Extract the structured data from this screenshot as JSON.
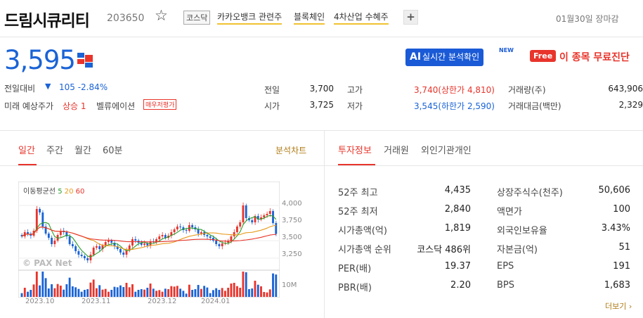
{
  "header": {
    "stock_name": "드림시큐리티",
    "stock_code": "203650",
    "star_icon": "☆",
    "market_badge": "코스닥",
    "themes": [
      "카카오뱅크 관련주",
      "블록체인",
      "4차산업 수혜주"
    ],
    "plus_label": "+",
    "date_text": "01월30일 장마감"
  },
  "price": {
    "current": "3,595",
    "change_label": "전일대비",
    "change_arrow": "▼",
    "change_text": "105 -2.84%",
    "forecast_label": "미래 예상주가",
    "forecast_value": "상승 1",
    "valuation_label": "벨류에이션",
    "valuation_button": "매우저평가"
  },
  "promo": {
    "ai_bold": "AI",
    "ai_text": "실시간 분석확인",
    "new_tag": "NEW",
    "free_tag": "Free",
    "free_text": "이 종목 무료진단"
  },
  "quote": {
    "prev_close_label": "전일",
    "prev_close": "3,700",
    "open_label": "시가",
    "open": "3,725",
    "high_label": "고가",
    "high": "3,740(상한가 4,810)",
    "low_label": "저가",
    "low": "3,545(하한가 2,590)",
    "volume_label": "거래량(주)",
    "volume": "643,906",
    "amount_label": "거래대금(백만)",
    "amount": "2,329"
  },
  "chart_tabs": {
    "tabs": [
      "일간",
      "주간",
      "월간",
      "60분"
    ],
    "analysis_link": "분석차트"
  },
  "info_tabs": [
    "투자정보",
    "거래원",
    "외인기관개인"
  ],
  "chart_legend": {
    "label": "이동평균선",
    "ma5": "5",
    "ma20": "20",
    "ma60": "60"
  },
  "chart_axis": {
    "y_ticks": [
      "4,000",
      "3,750",
      "3,500",
      "3,250"
    ],
    "volume_tick": "10M",
    "x_ticks": [
      "2023.10",
      "2023.11",
      "2023.12",
      "2024.01"
    ],
    "watermark": "© PAX Net"
  },
  "chart_data": {
    "type": "candlestick",
    "x": [
      "2023.10",
      "2023.11",
      "2023.12",
      "2024.01"
    ],
    "ylim": [
      3100,
      4200
    ],
    "y_ticks": [
      3250,
      3500,
      3750,
      4000
    ],
    "close": [
      3560,
      3620,
      3600,
      3570,
      3640,
      3950,
      3900,
      3700,
      3600,
      3540,
      3450,
      3500,
      3580,
      3640,
      3620,
      3560,
      3450,
      3420,
      3350,
      3300,
      3280,
      3250,
      3220,
      3300,
      3400,
      3420,
      3380,
      3430,
      3480,
      3500,
      3470,
      3420,
      3380,
      3330,
      3300,
      3360,
      3430,
      3520,
      3500,
      3470,
      3440,
      3460,
      3430,
      3490,
      3480,
      3520,
      3560,
      3580,
      3540,
      3570,
      3620,
      3660,
      3700,
      3690,
      3650,
      3640,
      3720,
      3690,
      3660,
      3600,
      3620,
      3580,
      3560,
      3540,
      3500,
      3450,
      3420,
      3460,
      3470,
      3500,
      3560,
      3620,
      3700,
      3760,
      4000,
      3820,
      3790,
      3760,
      3850,
      3800,
      3830,
      3860,
      3880,
      3920,
      3750,
      3595
    ],
    "ma_series": [
      {
        "name": "5",
        "color": "#2a9d2a"
      },
      {
        "name": "20",
        "color": "#e69a1b"
      },
      {
        "name": "60",
        "color": "#e8342b"
      }
    ],
    "volume_unit": "10M"
  },
  "invest_info": {
    "left": [
      {
        "label": "52주 최고",
        "value": "4,435"
      },
      {
        "label": "52주 최저",
        "value": "2,840"
      },
      {
        "label": "시가총액(억)",
        "value": "1,819"
      },
      {
        "label": "시가총액 순위",
        "value": "코스닥 486위"
      },
      {
        "label": "PER(배)",
        "value": "19.37"
      },
      {
        "label": "PBR(배)",
        "value": "2.20"
      }
    ],
    "right": [
      {
        "label": "상장주식수(천주)",
        "value": "50,606"
      },
      {
        "label": "액면가",
        "value": "100"
      },
      {
        "label": "외국인보유율",
        "value": "3.43%"
      },
      {
        "label": "자본금(억)",
        "value": "51"
      },
      {
        "label": "EPS",
        "value": "191"
      },
      {
        "label": "BPS",
        "value": "1,683"
      }
    ],
    "more_link": "더보기 ›"
  },
  "colors": {
    "up": "#e8342b",
    "down": "#1a63d6",
    "accent": "#e8342b"
  }
}
